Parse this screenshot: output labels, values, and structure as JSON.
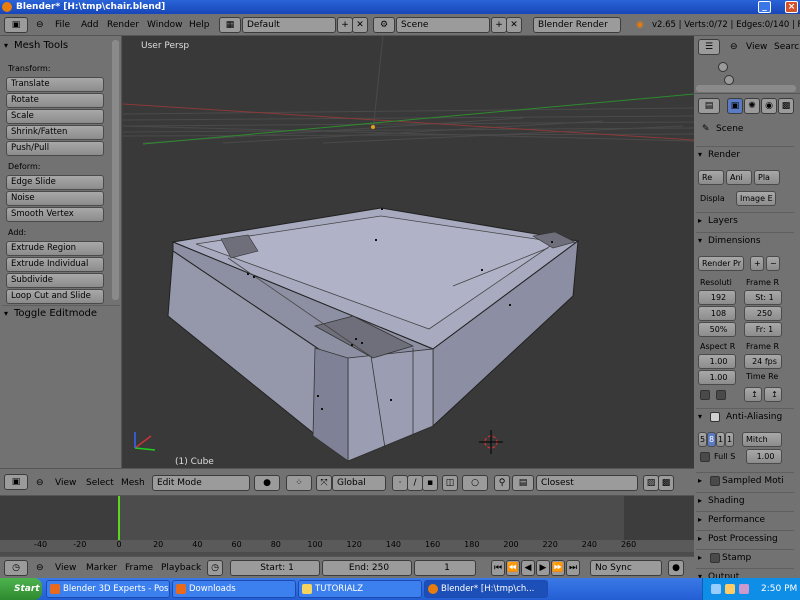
{
  "window": {
    "title": "Blender* [H:\\tmp\\chair.blend]",
    "controls": [
      "_",
      "□",
      "×"
    ]
  },
  "infobar": {
    "menus": [
      "File",
      "Add",
      "Render",
      "Window",
      "Help"
    ],
    "screen_layout": "Default",
    "scene": "Scene",
    "engine": "Blender Render",
    "stats": "v2.65 | Verts:0/72 | Edges:0/140 | Fac"
  },
  "toolshelf": {
    "title": "Mesh Tools",
    "groups": [
      {
        "label": "Transform:",
        "buttons": [
          "Translate",
          "Rotate",
          "Scale",
          "Shrink/Fatten",
          "Push/Pull"
        ]
      },
      {
        "label": "Deform:",
        "buttons": [
          "Edge Slide",
          "Noise",
          "Smooth Vertex"
        ]
      },
      {
        "label": "Add:",
        "buttons": [
          "Extrude Region",
          "Extrude Individual",
          "Subdivide",
          "Loop Cut and Slide"
        ]
      }
    ],
    "toggle_editmode": "Toggle Editmode"
  },
  "viewport": {
    "view_label": "User Persp",
    "object_label": "(1) Cube"
  },
  "view_header": {
    "menus": [
      "View",
      "Select",
      "Mesh"
    ],
    "mode": "Edit Mode",
    "orientation": "Global",
    "snap": "Closest"
  },
  "timeline": {
    "ticks": [
      "-40",
      "-20",
      "0",
      "20",
      "40",
      "60",
      "80",
      "100",
      "120",
      "140",
      "160",
      "180",
      "200",
      "220",
      "240",
      "260"
    ],
    "current_frame": 1
  },
  "timeline_header": {
    "menus": [
      "View",
      "Marker",
      "Frame",
      "Playback"
    ],
    "start": "Start: 1",
    "end": "End: 250",
    "frame": "1",
    "sync": "No Sync"
  },
  "outliner": {
    "menus": [
      "View",
      "Searc"
    ]
  },
  "properties": {
    "context": "Scene",
    "render_panel": {
      "title": "Render",
      "buttons": [
        "Re",
        "Ani",
        "Pla"
      ],
      "display_label": "Displa",
      "display_value": "Image E"
    },
    "layers_panel": "Layers",
    "dimensions_panel": {
      "title": "Dimensions",
      "preset": "Render Pr",
      "resolution_label": "Resoluti",
      "res_x": "192",
      "res_y": "108",
      "res_pct": "50%",
      "frame_range_label": "Frame R",
      "frame_start": "St: 1",
      "frame_end": "250",
      "frame_step": "Fr: 1",
      "aspect_label": "Aspect R",
      "aspect_x": "1.00",
      "aspect_y": "1.00",
      "fps_label": "Frame R",
      "fps": "24 fps",
      "time_remap_label": "Time Re"
    },
    "antialiasing_panel": {
      "title": "Anti-Aliasing",
      "samples": [
        "5",
        "8",
        "1",
        "1"
      ],
      "filter": "Mitch",
      "full_sample": "Full S",
      "filter_size": "1.00"
    },
    "collapsed_panels": [
      "Sampled Moti",
      "Shading",
      "Performance",
      "Post Processing",
      "Stamp",
      "Output"
    ]
  },
  "taskbar": {
    "start": "Start",
    "tasks": [
      "Blender 3D Experts - Pos...",
      "Downloads",
      "TUTORIALZ",
      "Blender* [H:\\tmp\\ch..."
    ],
    "clock": "2:50 PM"
  },
  "colors": {
    "panel_bg": "#727272",
    "viewport_bg": "#393939",
    "mesh_face": "#9a9db1",
    "mesh_top": "#a8abc0",
    "playhead": "#5bd61f"
  }
}
